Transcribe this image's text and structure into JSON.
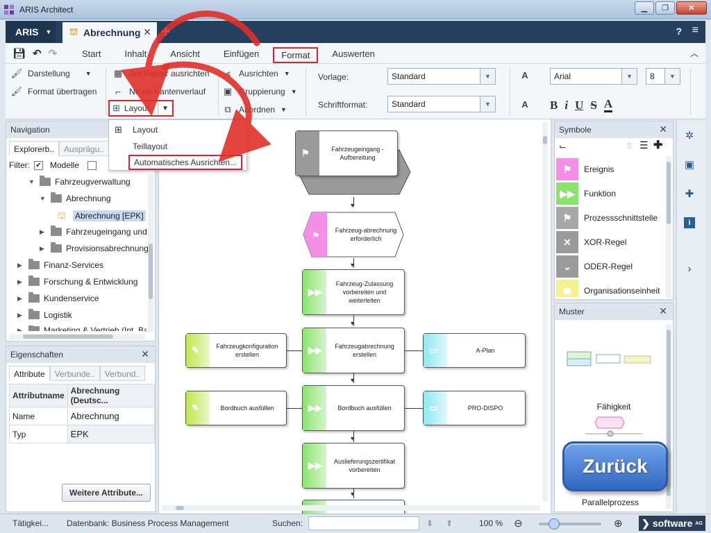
{
  "window": {
    "title": "ARIS Architect",
    "minimize": "▁",
    "maximize": "❐",
    "close": "✕"
  },
  "tabs": {
    "aris_label": "ARIS",
    "doc_tab": "Abrechnung",
    "help": "?",
    "menu": "≡"
  },
  "ribbon_menu": {
    "items": [
      "Start",
      "Inhalt",
      "Ansicht",
      "Einfügen",
      "Format",
      "Auswerten"
    ],
    "active": "Format"
  },
  "ribbon": {
    "darstellung": "Darstellung",
    "format_uebertragen": "Format übertragen",
    "am_raster": "Am Raster ausrichten",
    "neuer_kantenverlauf": "Neuer Kantenverlauf",
    "layout": "Layout",
    "ausrichten": "Ausrichten",
    "gruppierung": "Gruppierung",
    "anordnen": "Anordnen",
    "vorlage_label": "Vorlage:",
    "vorlage_value": "Standard",
    "schriftformat_label": "Schriftformat:",
    "schriftformat_value": "Standard",
    "font_value": "Arial",
    "size_value": "8",
    "fmt": [
      "B",
      "i",
      "U",
      "S",
      "A"
    ]
  },
  "layout_dropdown": {
    "items": [
      "Layout",
      "Teillayout",
      "Automatisches Ausrichten..."
    ]
  },
  "navigation": {
    "title": "Navigation",
    "tabs": [
      "Explorerb..",
      "Ausprägu.."
    ],
    "filter_label": "Filter:",
    "modelle_label": "Modelle",
    "tree": [
      "Fahrzeugverwaltung",
      "Abrechnung",
      "Abrechnung [EPK]",
      "Fahrzeugeingang und",
      "Provisionsabrechnung",
      "Finanz-Services",
      "Forschung & Entwicklung",
      "Kundenservice",
      "Logistik",
      "Marketing & Vertrieb (Int. Ba"
    ]
  },
  "properties": {
    "title": "Eigenschaften",
    "tabs": [
      "Attribute",
      "Verbunde..",
      "Verbund.."
    ],
    "header_name": "Attributname",
    "header_value": "Abrechnung (Deutsc...",
    "rows": [
      {
        "name": "Name",
        "value": "Abrechnung"
      },
      {
        "name": "Typ",
        "value": "EPK"
      }
    ],
    "more_button": "Weitere Attribute..."
  },
  "canvas": {
    "nodes": [
      "Fahrzeugeingang - Aufbereitung",
      "Fahrzeug-abrechnung erforderlich",
      "Fahrzeug-Zulassung vorbereiten und weiterleiten",
      "Fahrzeugkonfiguration erstellen",
      "Fahrzeugabrechnung erstellen",
      "A-Plan",
      "Bordbuch ausfüllen",
      "Bordbuch ausfüllen",
      "PRO-DISPO",
      "Auslieferungszertifikat vorbereiten"
    ]
  },
  "symbols": {
    "title": "Symbole",
    "items": [
      {
        "label": "Ereignis",
        "color": "#f58ee6",
        "icon": "flag-icon"
      },
      {
        "label": "Funktion",
        "color": "#8be36e",
        "icon": "play-icon"
      },
      {
        "label": "Prozessschnittstelle",
        "color": "#a8a8a8",
        "icon": "flag-icon"
      },
      {
        "label": "XOR-Regel",
        "color": "#9a9a9a",
        "icon": "x-icon"
      },
      {
        "label": "ODER-Regel",
        "color": "#9a9a9a",
        "icon": "chevron-icon"
      },
      {
        "label": "Organisationseinheit",
        "color": "#f5f28e",
        "icon": "org-icon"
      }
    ]
  },
  "muster": {
    "title": "Muster",
    "labels": [
      "Fähigkeit",
      "Parallelprozess"
    ],
    "zurueck": "Zurück"
  },
  "status": {
    "taetigkeit": "Tätigkei...",
    "datenbank": "Datenbank: Business Process Management",
    "suchen_label": "Suchen:",
    "zoom": "100 %",
    "brand": "software",
    "brand_ag": "AG"
  }
}
